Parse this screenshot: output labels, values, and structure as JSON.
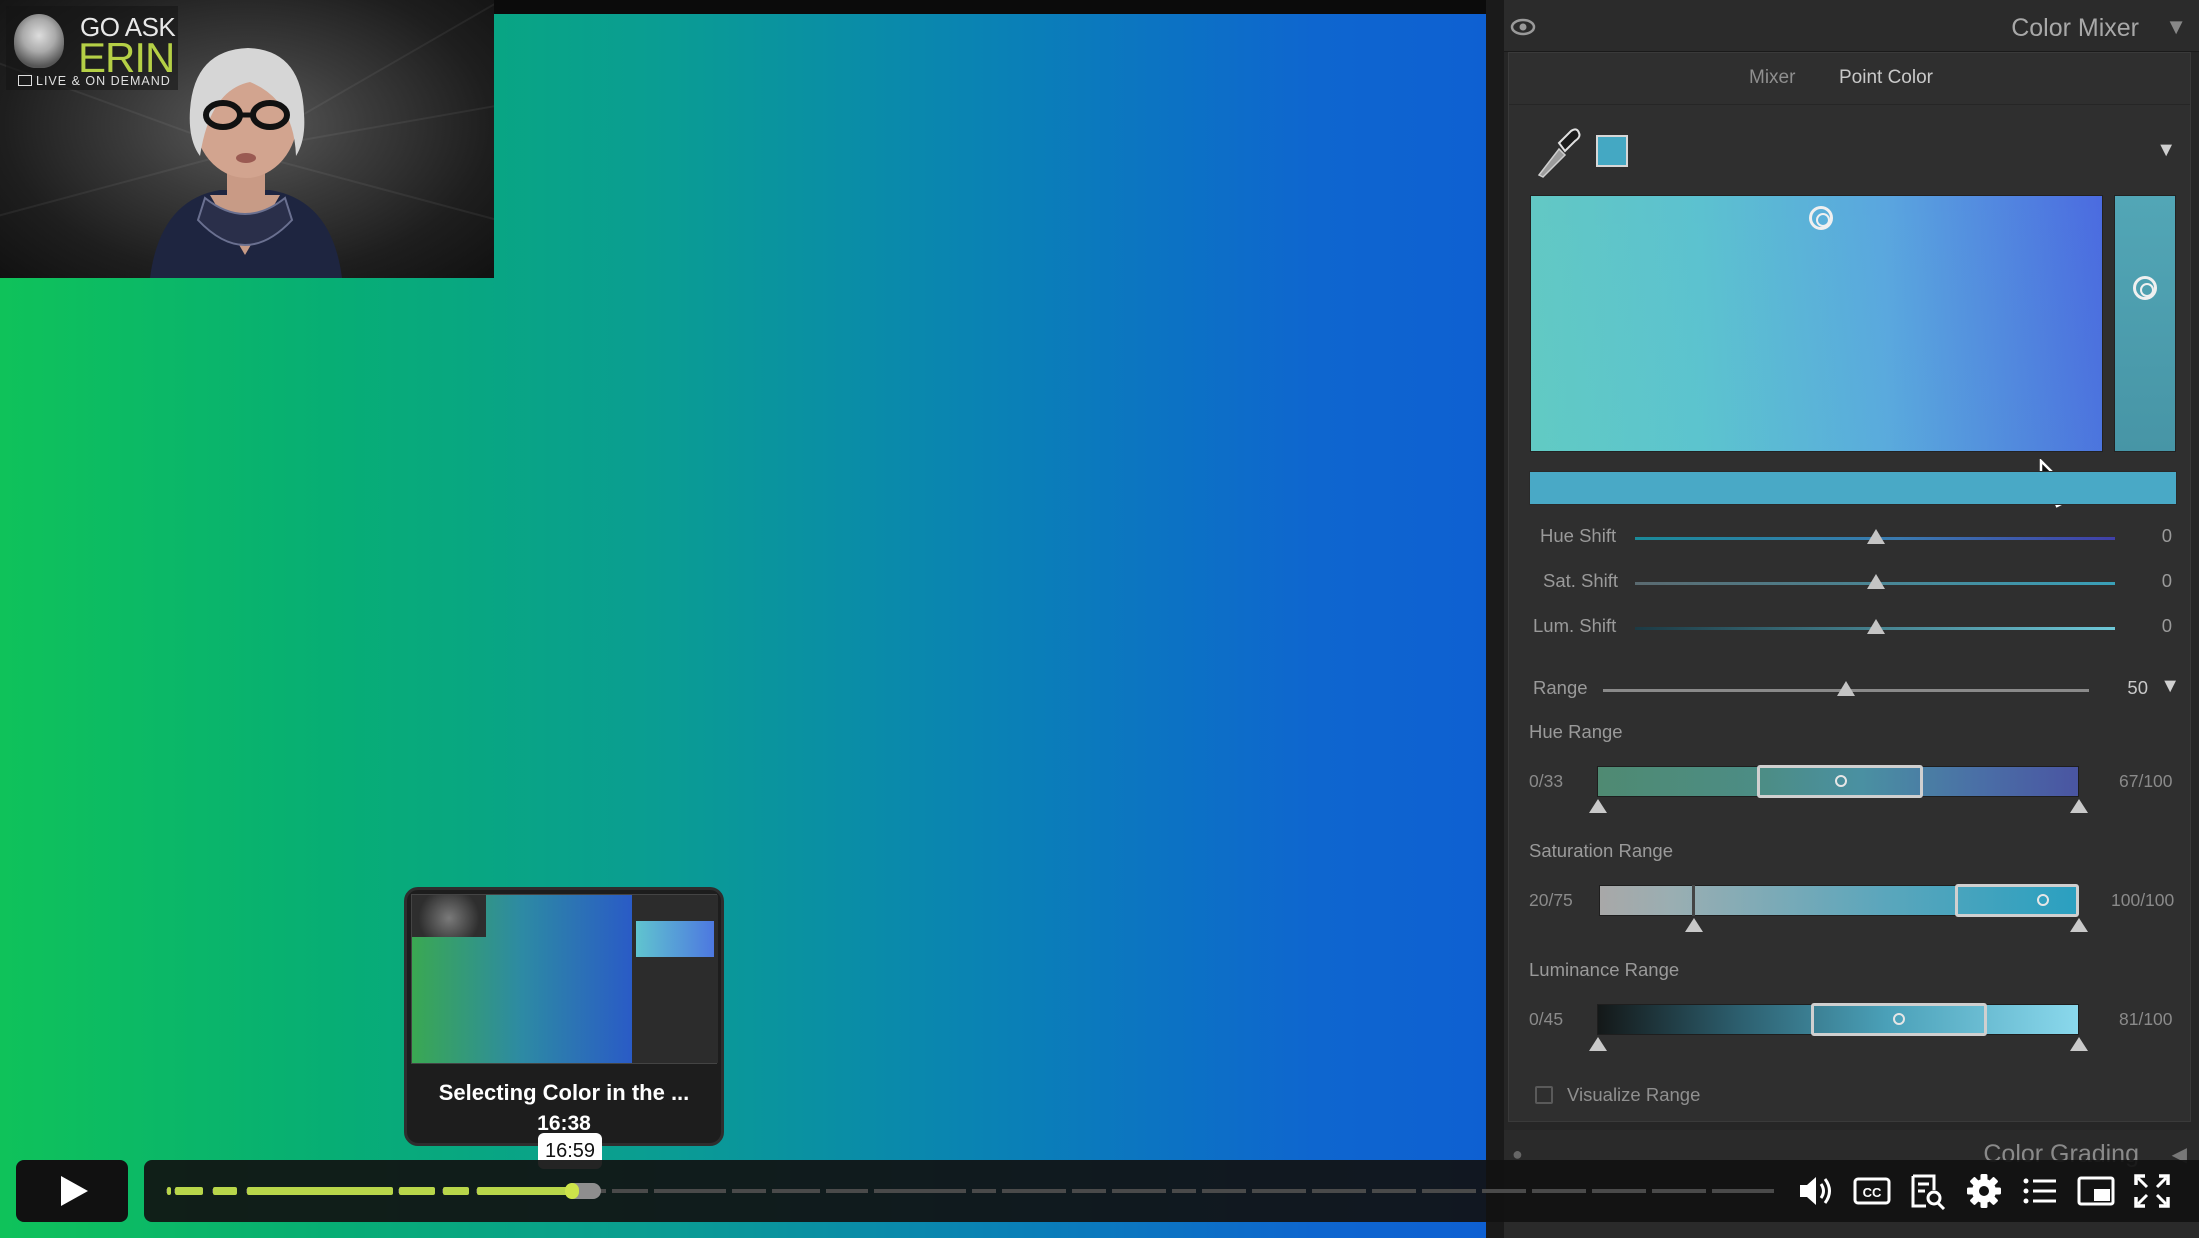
{
  "webcam": {
    "logo_line1": "GO ASK",
    "logo_line2": "ERIN",
    "logo_line3": "LIVE & ON DEMAND"
  },
  "panel": {
    "title": "Color Mixer",
    "tabs": [
      {
        "label": "Mixer",
        "active": false
      },
      {
        "label": "Point Color",
        "active": true
      }
    ],
    "selected_color": "#44a8c3",
    "sliders": [
      {
        "label": "Hue Shift",
        "value": "0"
      },
      {
        "label": "Sat. Shift",
        "value": "0"
      },
      {
        "label": "Lum. Shift",
        "value": "0"
      }
    ],
    "range": {
      "label": "Range",
      "value": "50"
    },
    "hue_range": {
      "label": "Hue Range",
      "low": "0/33",
      "high": "67/100"
    },
    "saturation_range": {
      "label": "Saturation Range",
      "low": "20/75",
      "high": "100/100"
    },
    "luminance_range": {
      "label": "Luminance Range",
      "low": "0/45",
      "high": "81/100"
    },
    "visualize_label": "Visualize Range",
    "next_section_title": "Color Grading"
  },
  "preview": {
    "title": "Selecting Color in the ...",
    "duration": "16:38",
    "hover_time": "16:59"
  },
  "player": {
    "progress_fraction": 0.254,
    "icons": [
      "play-icon",
      "volume-icon",
      "captions-icon",
      "transcript-icon",
      "settings-icon",
      "chapters-icon",
      "picture-in-picture-icon",
      "fullscreen-icon"
    ]
  },
  "colors": {
    "accent_progress": "#b8d64a",
    "panel_bg": "#2f2f2f"
  }
}
